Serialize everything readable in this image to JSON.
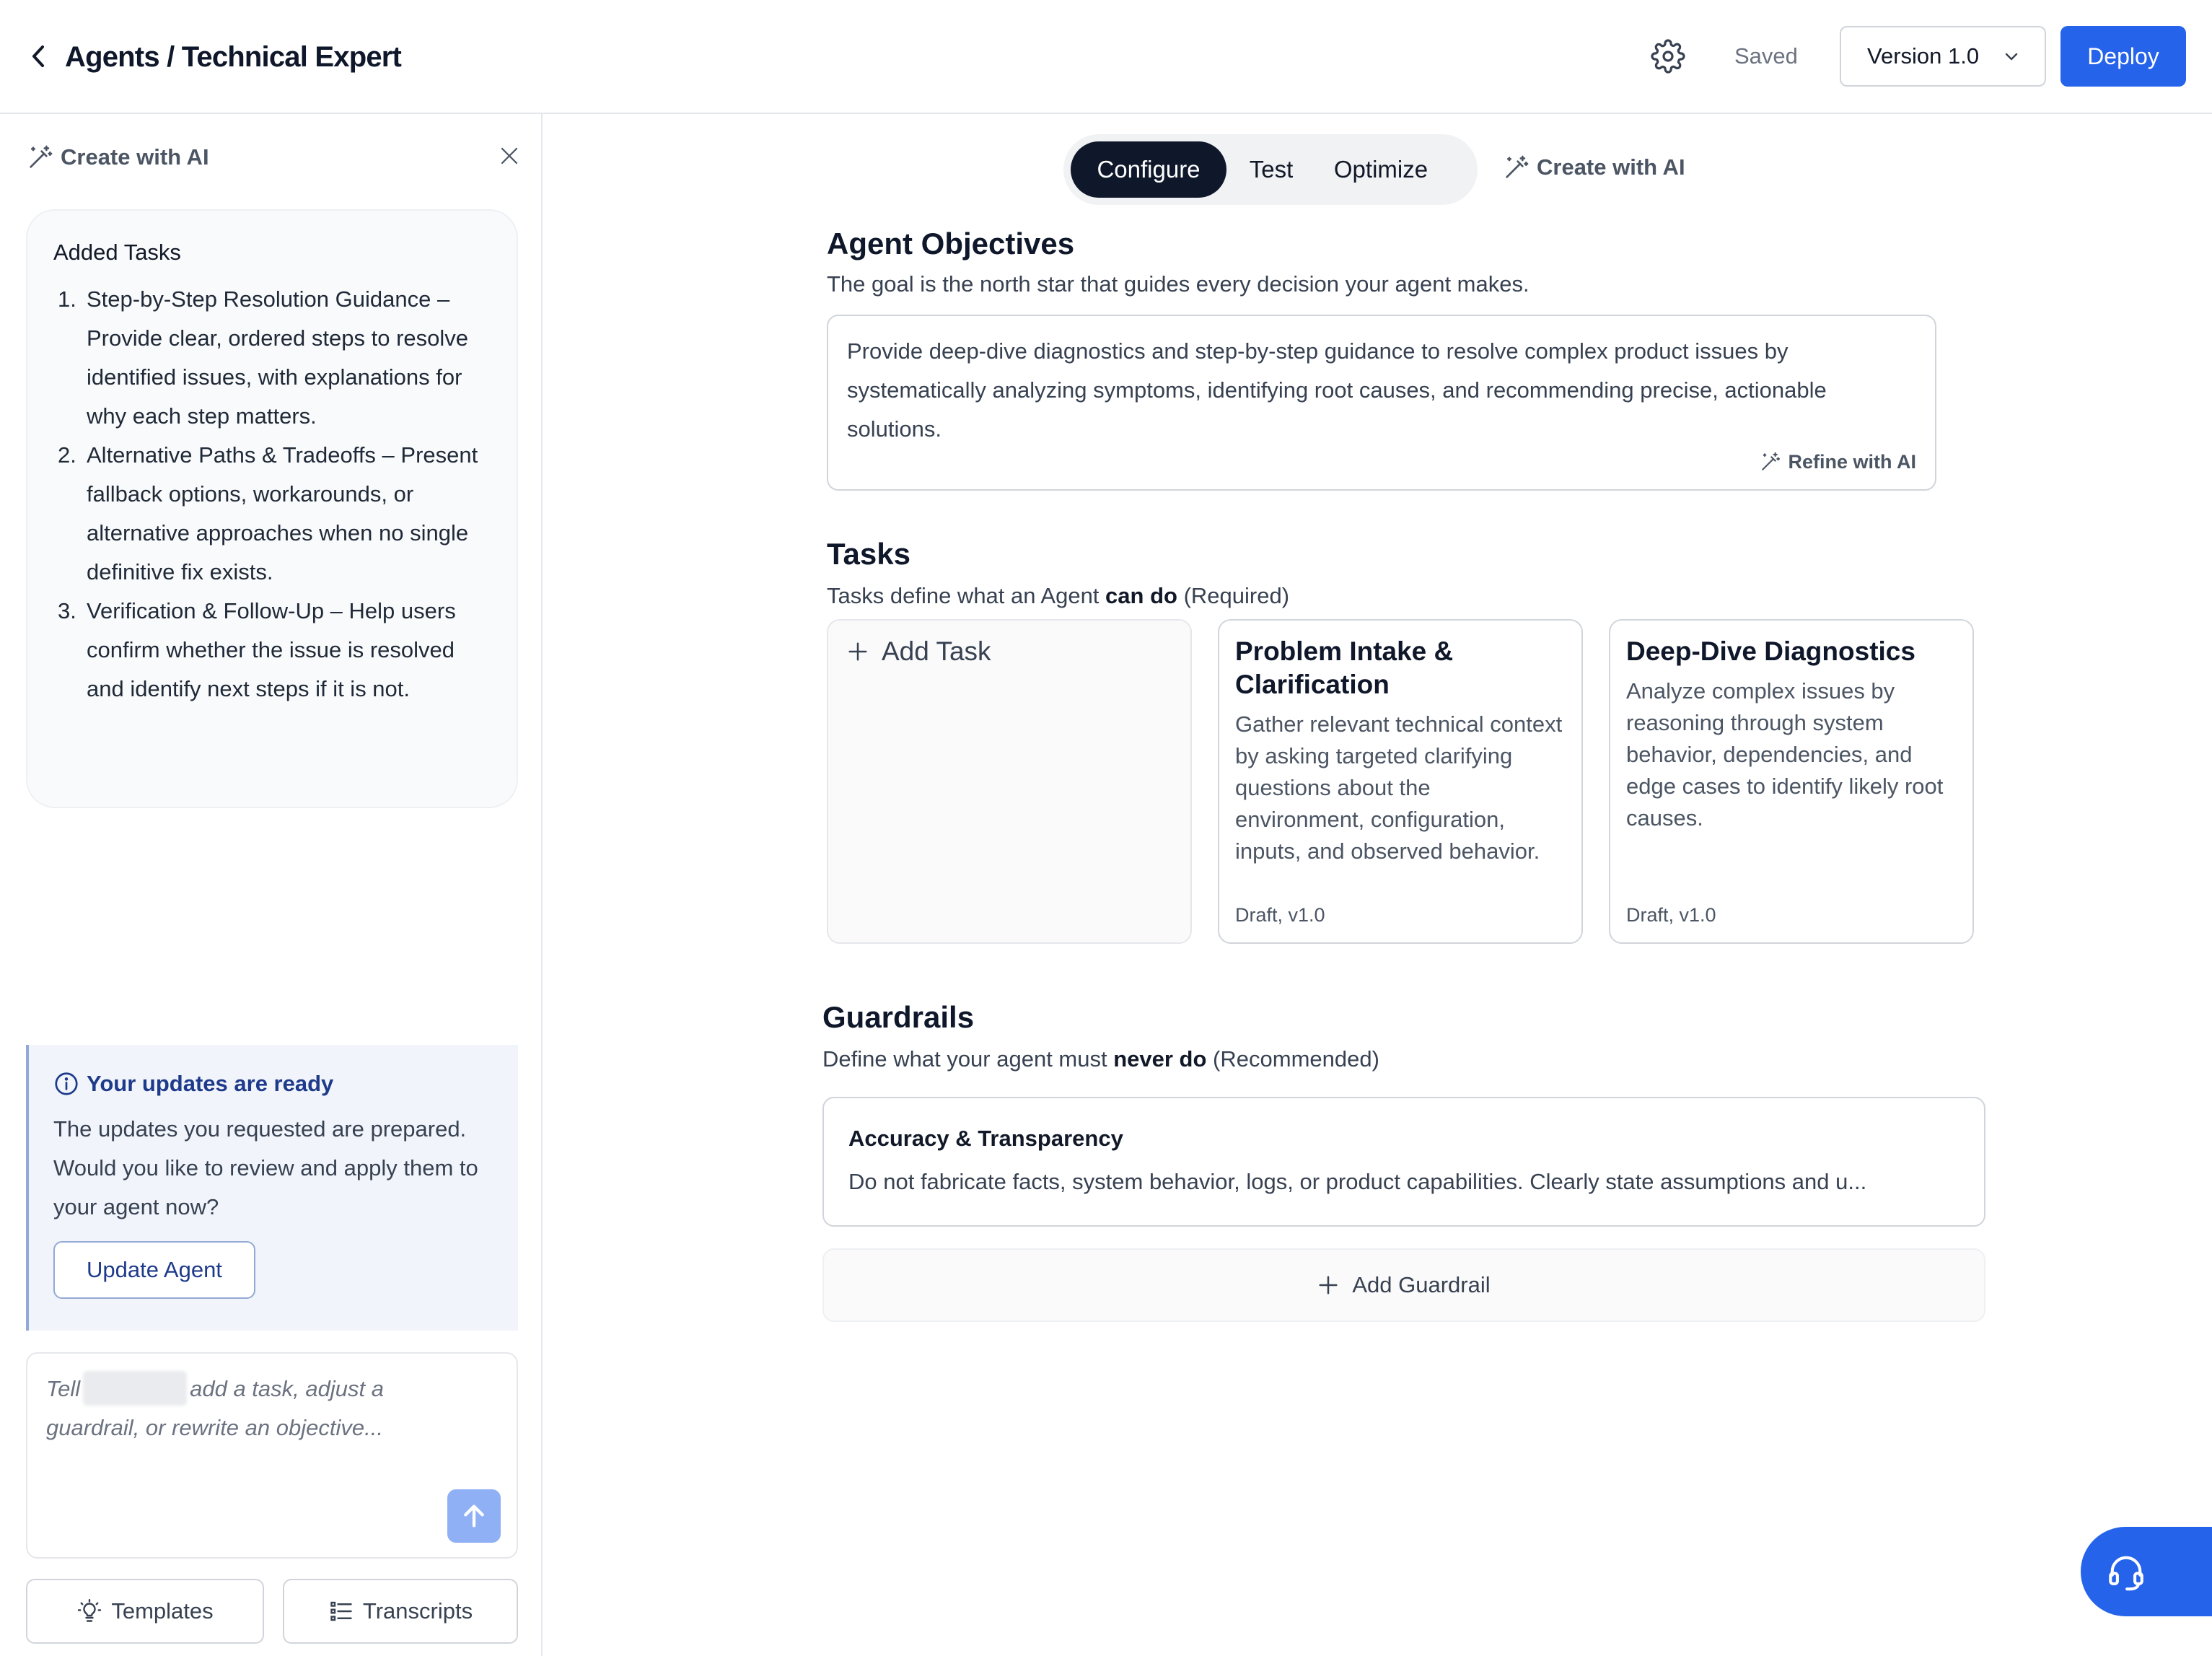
{
  "header": {
    "title": "Agents / Technical Expert",
    "saved_label": "Saved",
    "version_label": "Version 1.0",
    "deploy_label": "Deploy"
  },
  "left_panel": {
    "create_with_ai_label": "Create with AI",
    "tasks_card": {
      "title": "Added Tasks",
      "items": [
        {
          "num": "1.",
          "text": "Step-by-Step Resolution Guidance – Provide clear, ordered steps to resolve identified issues, with explanations for why each step matters."
        },
        {
          "num": "2.",
          "text": "Alternative Paths & Tradeoffs – Present fallback options, workarounds, or alternative approaches when no single definitive fix exists."
        },
        {
          "num": "3.",
          "text": "Verification & Follow-Up – Help users confirm whether the issue is resolved and identify next steps if it is not."
        }
      ]
    },
    "updates": {
      "title": "Your updates are ready",
      "body": "The updates you requested are prepared. Would you like to review and apply them to your agent now?",
      "button_label": "Update Agent"
    },
    "chat": {
      "placeholder_prefix": "Tell",
      "placeholder_suffix": "add a task, adjust a guardrail, or rewrite an objective..."
    },
    "templates_label": "Templates",
    "transcripts_label": "Transcripts"
  },
  "main": {
    "tabs": [
      {
        "label": "Configure",
        "active": true
      },
      {
        "label": "Test",
        "active": false
      },
      {
        "label": "Optimize",
        "active": false
      }
    ],
    "create_with_ai_label": "Create with AI",
    "objectives": {
      "title": "Agent Objectives",
      "subtitle": "The goal is the north star that guides every decision your agent makes.",
      "text": "Provide deep-dive diagnostics and step-by-step guidance to resolve complex product issues by systematically analyzing symptoms, identifying root causes, and recommending precise, actionable solutions.",
      "refine_label": "Refine with AI"
    },
    "tasks": {
      "title": "Tasks",
      "subtitle_pre": "Tasks define what an Agent ",
      "subtitle_bold": "can do",
      "subtitle_post": " (Required)",
      "add_label": "Add Task",
      "cards": [
        {
          "title": "Problem Intake & Clarification",
          "description": "Gather relevant technical context by asking targeted clarifying questions about the environment, configuration, inputs, and observed behavior.",
          "meta": "Draft, v1.0"
        },
        {
          "title": "Deep-Dive Diagnostics",
          "description": "Analyze complex issues by reasoning through system behavior, dependencies, and edge cases to identify likely root causes.",
          "meta": "Draft, v1.0"
        }
      ]
    },
    "guardrails": {
      "title": "Guardrails",
      "subtitle_pre": "Define what your agent must ",
      "subtitle_bold": "never do",
      "subtitle_post": " (Recommended)",
      "items": [
        {
          "title": "Accuracy & Transparency",
          "description": "Do not fabricate facts, system behavior, logs, or product capabilities. Clearly state assumptions and u..."
        }
      ],
      "add_label": "Add Guardrail"
    }
  },
  "colors": {
    "primary": "#2563eb",
    "active_tab": "#0f172a",
    "info_bg": "#f1f5fb",
    "info_text": "#1e3a8a"
  },
  "icons": {
    "back": "chevron-left-icon",
    "settings": "gear-icon",
    "version_dropdown": "chevron-down-icon",
    "create_ai": "magic-wand-icon",
    "close": "close-icon",
    "info": "info-icon",
    "send": "arrow-up-icon",
    "templates": "lightbulb-icon",
    "transcripts": "list-icon",
    "add": "plus-icon",
    "support": "headset-icon"
  }
}
